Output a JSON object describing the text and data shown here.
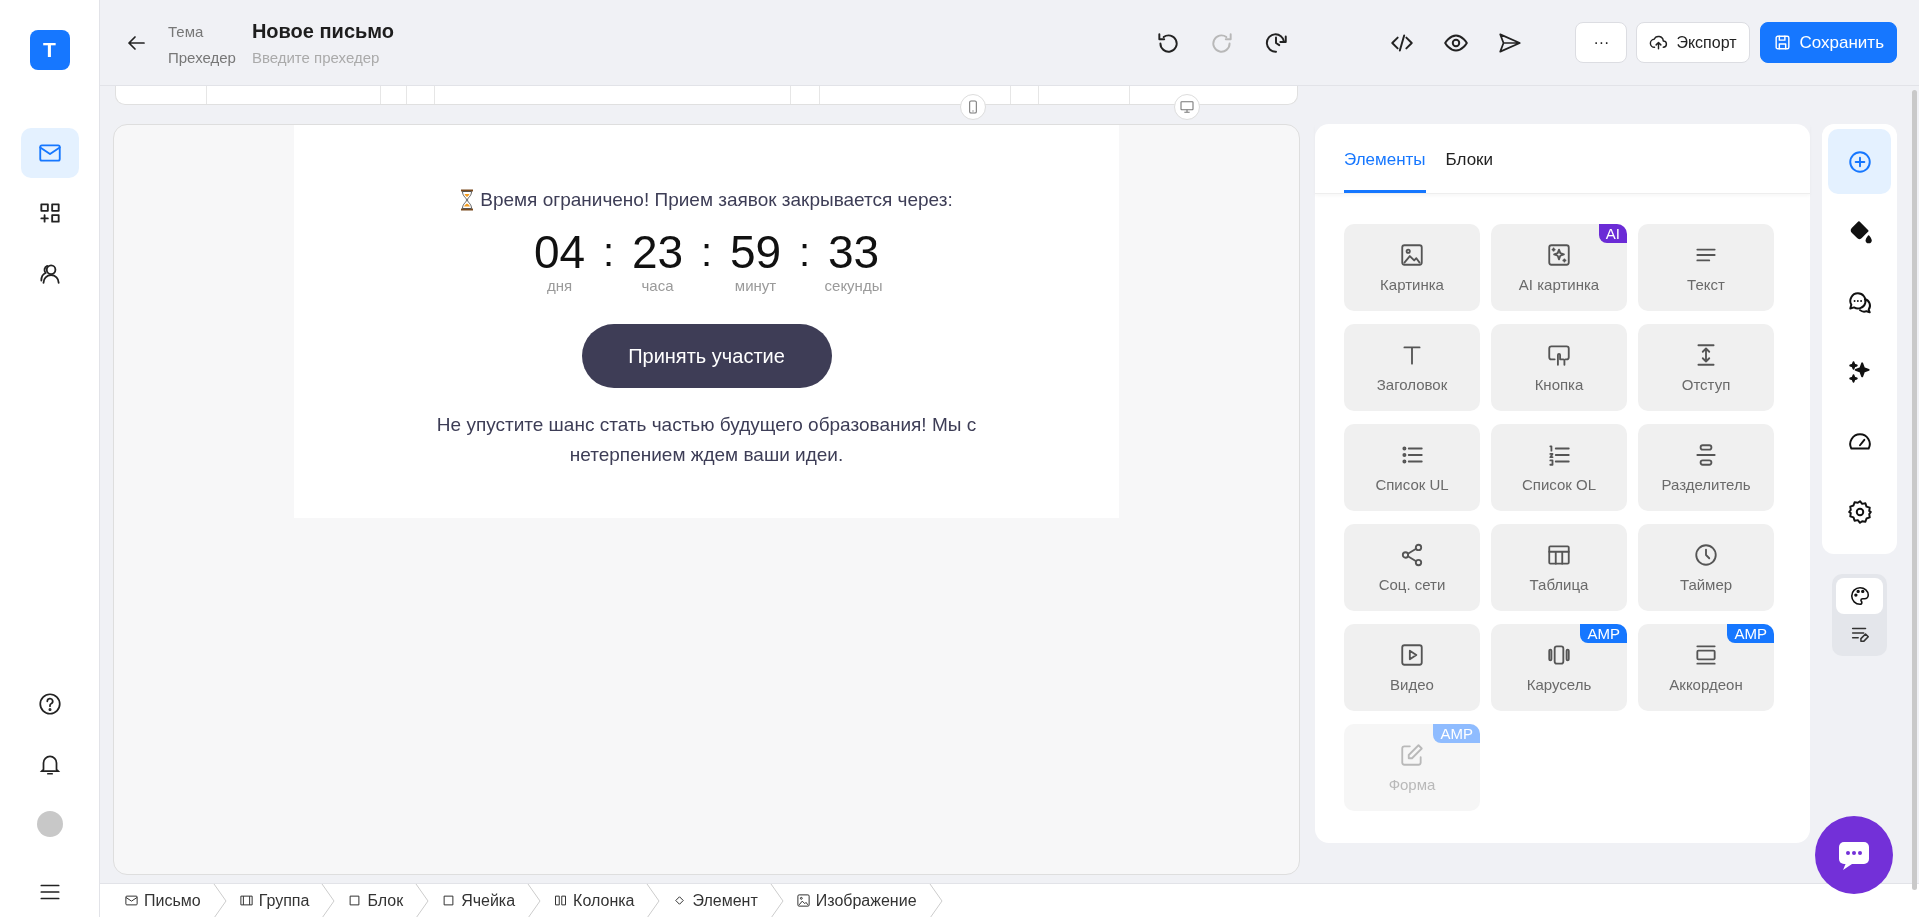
{
  "sidebar": {
    "logo": "T",
    "nav": [
      {
        "kind": "mail",
        "selected": true
      },
      {
        "kind": "blocks",
        "selected": false
      },
      {
        "kind": "users",
        "selected": false
      }
    ]
  },
  "header": {
    "subject_label": "Тема",
    "subject": "Новое письмо",
    "preheader_label": "Прехедер",
    "preheader_placeholder": "Введите прехедер",
    "history": [
      {
        "kind": "undo",
        "disabled": false
      },
      {
        "kind": "redo",
        "disabled": true
      },
      {
        "kind": "history",
        "disabled": false
      }
    ],
    "more": "···",
    "export": "Экспорт",
    "save": "Сохранить"
  },
  "email": {
    "intro": "Время ограничено! Прием заявок закрывается через:",
    "separator": ":",
    "timer": [
      {
        "value": "04",
        "unit": "дня"
      },
      {
        "value": "23",
        "unit": "часа"
      },
      {
        "value": "59",
        "unit": "минут"
      },
      {
        "value": "33",
        "unit": "секунды"
      }
    ],
    "button": "Принять участие",
    "text": "Не упустите шанс стать частью будущего образования! Мы с нетерпением ждем ваши идеи."
  },
  "panel": {
    "tabs": [
      {
        "label": "Элементы",
        "selected": true
      },
      {
        "label": "Блоки",
        "selected": false
      }
    ],
    "elements": [
      {
        "kind": "image",
        "label": "Картинка",
        "disabled": false
      },
      {
        "kind": "ai-image",
        "label": "AI картинка",
        "disabled": false,
        "badge": {
          "kind": "ai",
          "label": "AI"
        }
      },
      {
        "kind": "text",
        "label": "Текст",
        "disabled": false
      },
      {
        "kind": "heading",
        "label": "Заголовок",
        "disabled": false
      },
      {
        "kind": "button",
        "label": "Кнопка",
        "disabled": false
      },
      {
        "kind": "spacer",
        "label": "Отступ",
        "disabled": false
      },
      {
        "kind": "ul",
        "label": "Список UL",
        "disabled": false
      },
      {
        "kind": "ol",
        "label": "Список OL",
        "disabled": false
      },
      {
        "kind": "divider",
        "label": "Разделитель",
        "disabled": false
      },
      {
        "kind": "social",
        "label": "Соц. сети",
        "disabled": false
      },
      {
        "kind": "table",
        "label": "Таблица",
        "disabled": false
      },
      {
        "kind": "timer",
        "label": "Таймер",
        "disabled": false
      },
      {
        "kind": "video",
        "label": "Видео",
        "disabled": false
      },
      {
        "kind": "carousel",
        "label": "Карусель",
        "disabled": false,
        "badge": {
          "kind": "amp",
          "label": "AMP"
        }
      },
      {
        "kind": "accordion",
        "label": "Аккордеон",
        "disabled": false,
        "badge": {
          "kind": "amp",
          "label": "AMP"
        }
      },
      {
        "kind": "form",
        "label": "Форма",
        "disabled": true,
        "badge": {
          "kind": "amp",
          "label": "AMP"
        }
      }
    ]
  },
  "rail": {
    "items": [
      {
        "kind": "add",
        "selected": true
      },
      {
        "kind": "paint",
        "selected": false
      },
      {
        "kind": "comments",
        "selected": false
      },
      {
        "kind": "sparkles",
        "selected": false
      },
      {
        "kind": "gauge",
        "selected": false
      },
      {
        "kind": "settings",
        "selected": false
      }
    ],
    "modes": [
      {
        "kind": "palette",
        "selected": true
      },
      {
        "kind": "edit-list",
        "selected": false
      }
    ]
  },
  "breadcrumbs": [
    {
      "kind": "mail",
      "label": "Письмо"
    },
    {
      "kind": "group",
      "label": "Группа"
    },
    {
      "kind": "square",
      "label": "Блок"
    },
    {
      "kind": "square",
      "label": "Ячейка"
    },
    {
      "kind": "columns",
      "label": "Колонка"
    },
    {
      "kind": "diamond",
      "label": "Элемент"
    },
    {
      "kind": "image",
      "label": "Изображение"
    }
  ]
}
